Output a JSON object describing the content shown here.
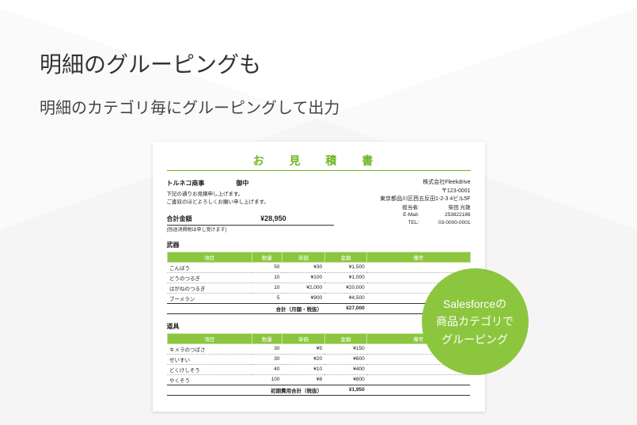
{
  "page": {
    "heading": "明細のグルーピングも",
    "subheading": "明細のカテゴリ毎にグルーピングして出力"
  },
  "badge": {
    "line1": "Salesforceの",
    "line2": "商品カテゴリで",
    "line3": "グルーピング"
  },
  "doc": {
    "title": "お 見 積 書",
    "client_name": "トルネコ商事",
    "client_suffix": "御中",
    "intro_line1": "下記の通りお見積申し上げます。",
    "intro_line2": "ご査収のほどよろしくお願い申し上げます。",
    "total_label": "合計金額",
    "total_note": "(別途消費税は申し受けます)",
    "total_amount": "¥28,950",
    "company": {
      "name": "株式会社Fleekdrive",
      "zip": "〒123-0001",
      "address": "東京都品川区西五反田1-2-3 4ビル5F",
      "contact_label": "担当者:",
      "contact": "柴田 光雄",
      "email_label": "E-Mail:",
      "email": "253822186",
      "tel_label": "TEL:",
      "tel": "03-0000-0001"
    },
    "headers": {
      "item": "項目",
      "qty": "数量",
      "unit": "単価",
      "amount": "金額",
      "note": "備考"
    },
    "groups": [
      {
        "title": "武器",
        "items": [
          {
            "name": "こんぼう",
            "qty": "50",
            "unit": "¥30",
            "amount": "¥1,500",
            "note": ""
          },
          {
            "name": "どうのつるぎ",
            "qty": "10",
            "unit": "¥100",
            "amount": "¥1,000",
            "note": ""
          },
          {
            "name": "はがねのつるぎ",
            "qty": "10",
            "unit": "¥2,000",
            "amount": "¥20,000",
            "note": ""
          },
          {
            "name": "ブーメラン",
            "qty": "5",
            "unit": "¥900",
            "amount": "¥4,500",
            "note": ""
          }
        ],
        "subtotal_label": "合計（月額・税抜）",
        "subtotal": "¥27,000"
      },
      {
        "title": "道具",
        "items": [
          {
            "name": "キメラのつばさ",
            "qty": "30",
            "unit": "¥5",
            "amount": "¥150",
            "note": ""
          },
          {
            "name": "せいすい",
            "qty": "30",
            "unit": "¥20",
            "amount": "¥600",
            "note": ""
          },
          {
            "name": "どくけしそう",
            "qty": "40",
            "unit": "¥10",
            "amount": "¥400",
            "note": ""
          },
          {
            "name": "やくそう",
            "qty": "100",
            "unit": "¥8",
            "amount": "¥800",
            "note": ""
          }
        ],
        "subtotal_label": "初期費用合計（税抜）",
        "subtotal": "¥1,950"
      }
    ]
  }
}
